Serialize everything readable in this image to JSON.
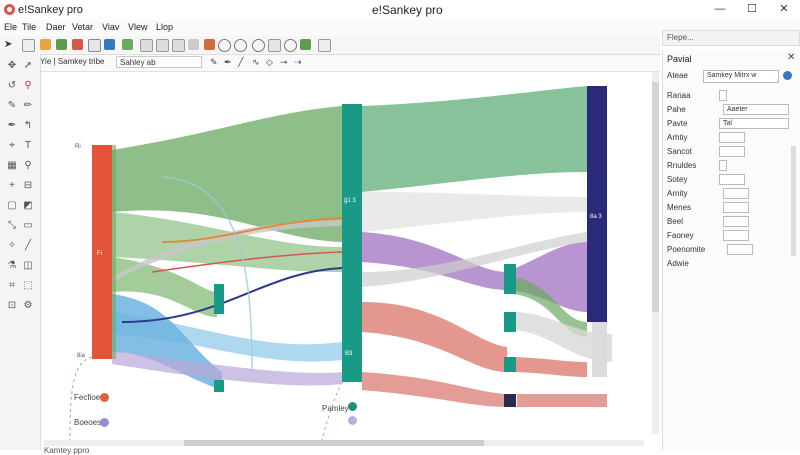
{
  "window": {
    "app_name": "e!Sankey pro",
    "title": "e!Sankey pro",
    "minimize": "—",
    "maximize": "☐",
    "close": "✕"
  },
  "menu": [
    "Ele",
    "Tile",
    "Daer",
    "Vetar",
    "Viav",
    "Vlew",
    "Llop"
  ],
  "doc_bar": {
    "tab_label": "Yie  |  Samkey tribe",
    "field_value": "Sahley  ab"
  },
  "status": {
    "text": "Kamtey ppro"
  },
  "panel_top": {
    "label": "Flepe..."
  },
  "properties": {
    "header": "Pavial",
    "name_label": "Ateae",
    "name_value": "Samkey Mitrx w",
    "rows": [
      {
        "label": "Ranaa",
        "value": ""
      },
      {
        "label": "Pahe",
        "value": "Aaeter"
      },
      {
        "label": "Pavte",
        "value": "Tal"
      },
      {
        "label": "Arhtiy",
        "value": ""
      },
      {
        "label": "Sancot",
        "value": ""
      },
      {
        "label": "Rnuldes",
        "value": ""
      },
      {
        "label": "Sotey",
        "value": ""
      },
      {
        "label": "Arnity",
        "value": ""
      },
      {
        "label": "Menes",
        "value": ""
      },
      {
        "label": "Beel",
        "value": ""
      },
      {
        "label": "Faoney",
        "value": ""
      },
      {
        "label": "Poenomite",
        "value": ""
      },
      {
        "label": "Adwie",
        "value": ""
      }
    ]
  },
  "diagram": {
    "node_labels": [
      "Ri",
      "Fi",
      "8ia",
      "ĝ1 3",
      "B3",
      "8a 3"
    ],
    "legend": [
      {
        "label": "Fecfioe",
        "color": "#e0643a"
      },
      {
        "label": "Boeoes",
        "color": "#9a8ec7"
      },
      {
        "label": "Pamley",
        "color": "#1f8f7a"
      }
    ],
    "colors": {
      "red": "#e2553a",
      "green": "#6aaa60",
      "teal": "#1a9a86",
      "blue": "#5aa8dc",
      "purple": "#a070c0",
      "navy": "#2b2a7a",
      "salmon": "#d9746a"
    }
  }
}
